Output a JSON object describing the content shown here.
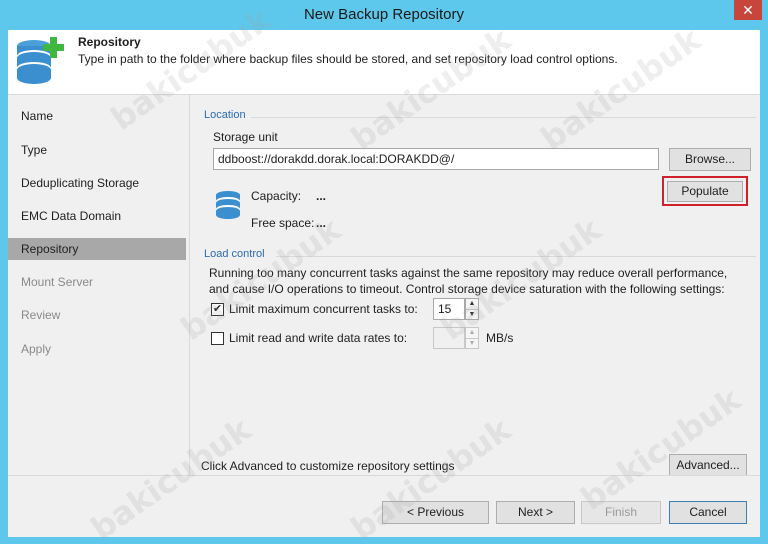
{
  "window": {
    "title": "New Backup Repository",
    "close_glyph": "✕"
  },
  "header": {
    "title": "Repository",
    "description": "Type in path to the folder where backup files should be stored, and set repository load control options.",
    "icon": "database-add-icon"
  },
  "nav": {
    "items": [
      {
        "label": "Name",
        "state": "normal"
      },
      {
        "label": "Type",
        "state": "normal"
      },
      {
        "label": "Deduplicating Storage",
        "state": "normal"
      },
      {
        "label": "EMC Data Domain",
        "state": "normal"
      },
      {
        "label": "Repository",
        "state": "active"
      },
      {
        "label": "Mount Server",
        "state": "disabled"
      },
      {
        "label": "Review",
        "state": "disabled"
      },
      {
        "label": "Apply",
        "state": "disabled"
      }
    ]
  },
  "location": {
    "group_label": "Location",
    "storage_unit_label": "Storage unit",
    "storage_unit_value": "ddboost://dorakdd.dorak.local:DORAKDD@/",
    "browse_label": "Browse...",
    "populate_label": "Populate",
    "capacity_label": "Capacity:",
    "capacity_value": "...",
    "free_space_label": "Free space:",
    "free_space_value": "..."
  },
  "load_control": {
    "group_label": "Load control",
    "description_line1": "Running too many concurrent tasks against the same repository may reduce overall performance,",
    "description_line2": "and cause I/O operations to timeout. Control storage device saturation with the following settings:",
    "limit_tasks_label": "Limit maximum concurrent tasks to:",
    "limit_tasks_checked": true,
    "limit_tasks_value": "15",
    "limit_rate_label": "Limit read and write data rates to:",
    "limit_rate_checked": false,
    "limit_rate_value": "",
    "rate_unit": "MB/s",
    "check_glyph": "✔"
  },
  "advanced": {
    "hint": "Click Advanced to customize repository settings",
    "button_label": "Advanced..."
  },
  "footer": {
    "previous_label": "< Previous",
    "next_label": "Next >",
    "finish_label": "Finish",
    "cancel_label": "Cancel"
  },
  "watermark": "bakicubuk",
  "colors": {
    "accent": "#5ec8ec",
    "group_label": "#2b6cb0",
    "highlight": "#d0202a",
    "active_nav": "#a8a8a8"
  }
}
